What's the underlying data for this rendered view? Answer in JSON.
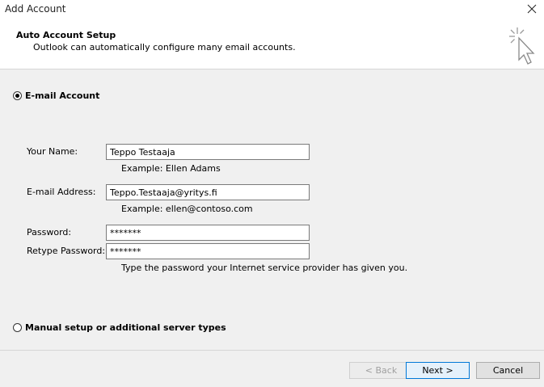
{
  "window": {
    "title": "Add Account"
  },
  "header": {
    "title": "Auto Account Setup",
    "subtitle": "Outlook can automatically configure many email accounts."
  },
  "options": {
    "email_account": {
      "label": "E-mail Account",
      "selected": true
    },
    "manual_setup": {
      "label": "Manual setup or additional server types",
      "selected": false
    }
  },
  "form": {
    "name": {
      "label": "Your Name:",
      "value": "Teppo Testaaja",
      "example": "Example: Ellen Adams"
    },
    "email": {
      "label": "E-mail Address:",
      "value": "Teppo.Testaaja@yritys.fi",
      "example": "Example: ellen@contoso.com"
    },
    "password": {
      "label": "Password:",
      "value": "*******"
    },
    "retype_password": {
      "label": "Retype Password:",
      "value": "*******"
    },
    "password_hint": "Type the password your Internet service provider has given you."
  },
  "buttons": {
    "back": "< Back",
    "next": "Next >",
    "cancel": "Cancel"
  },
  "icons": {
    "close": "close-icon",
    "header": "cursor-click-icon"
  }
}
